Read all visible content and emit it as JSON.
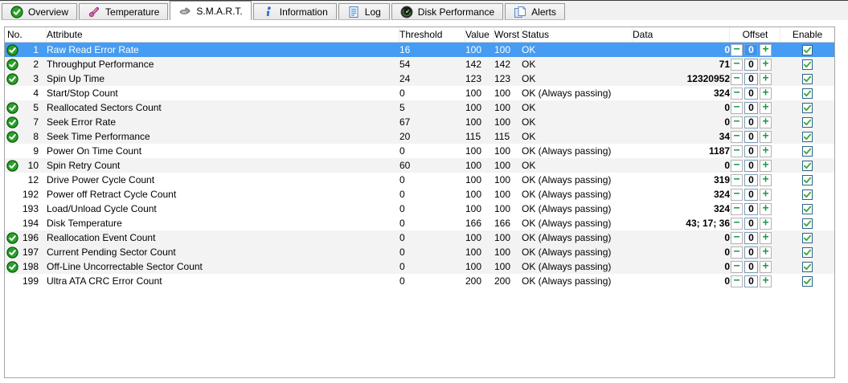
{
  "tabs": [
    {
      "label": "Overview",
      "icon": "check-circle-icon",
      "active": false
    },
    {
      "label": "Temperature",
      "icon": "thermometer-icon",
      "active": false
    },
    {
      "label": "S.M.A.R.T.",
      "icon": "smart-icon",
      "active": true
    },
    {
      "label": "Information",
      "icon": "info-icon",
      "active": false
    },
    {
      "label": "Log",
      "icon": "log-icon",
      "active": false
    },
    {
      "label": "Disk Performance",
      "icon": "gauge-icon",
      "active": false
    },
    {
      "label": "Alerts",
      "icon": "alerts-icon",
      "active": false
    }
  ],
  "table": {
    "headers": {
      "no": "No.",
      "attribute": "Attribute",
      "threshold": "Threshold",
      "value": "Value",
      "worst": "Worst",
      "status": "Status",
      "data": "Data",
      "offset": "Offset",
      "enable": "Enable"
    },
    "rows": [
      {
        "no": "1",
        "good": true,
        "selected": true,
        "attribute": "Raw Read Error Rate",
        "threshold": "16",
        "value": "100",
        "worst": "100",
        "status": "OK",
        "data": "0",
        "offset": "0",
        "enabled": true
      },
      {
        "no": "2",
        "good": true,
        "selected": false,
        "attribute": "Throughput Performance",
        "threshold": "54",
        "value": "142",
        "worst": "142",
        "status": "OK",
        "data": "71",
        "offset": "0",
        "enabled": true
      },
      {
        "no": "3",
        "good": true,
        "selected": false,
        "attribute": "Spin Up Time",
        "threshold": "24",
        "value": "123",
        "worst": "123",
        "status": "OK",
        "data": "12320952",
        "offset": "0",
        "enabled": true
      },
      {
        "no": "4",
        "good": false,
        "selected": false,
        "attribute": "Start/Stop Count",
        "threshold": "0",
        "value": "100",
        "worst": "100",
        "status": "OK (Always passing)",
        "data": "324",
        "offset": "0",
        "enabled": true
      },
      {
        "no": "5",
        "good": true,
        "selected": false,
        "attribute": "Reallocated Sectors Count",
        "threshold": "5",
        "value": "100",
        "worst": "100",
        "status": "OK",
        "data": "0",
        "offset": "0",
        "enabled": true
      },
      {
        "no": "7",
        "good": true,
        "selected": false,
        "attribute": "Seek Error Rate",
        "threshold": "67",
        "value": "100",
        "worst": "100",
        "status": "OK",
        "data": "0",
        "offset": "0",
        "enabled": true
      },
      {
        "no": "8",
        "good": true,
        "selected": false,
        "attribute": "Seek Time Performance",
        "threshold": "20",
        "value": "115",
        "worst": "115",
        "status": "OK",
        "data": "34",
        "offset": "0",
        "enabled": true
      },
      {
        "no": "9",
        "good": false,
        "selected": false,
        "attribute": "Power On Time Count",
        "threshold": "0",
        "value": "100",
        "worst": "100",
        "status": "OK (Always passing)",
        "data": "1187",
        "offset": "0",
        "enabled": true
      },
      {
        "no": "10",
        "good": true,
        "selected": false,
        "attribute": "Spin Retry Count",
        "threshold": "60",
        "value": "100",
        "worst": "100",
        "status": "OK",
        "data": "0",
        "offset": "0",
        "enabled": true
      },
      {
        "no": "12",
        "good": false,
        "selected": false,
        "attribute": "Drive Power Cycle Count",
        "threshold": "0",
        "value": "100",
        "worst": "100",
        "status": "OK (Always passing)",
        "data": "319",
        "offset": "0",
        "enabled": true
      },
      {
        "no": "192",
        "good": false,
        "selected": false,
        "attribute": "Power off Retract Cycle Count",
        "threshold": "0",
        "value": "100",
        "worst": "100",
        "status": "OK (Always passing)",
        "data": "324",
        "offset": "0",
        "enabled": true
      },
      {
        "no": "193",
        "good": false,
        "selected": false,
        "attribute": "Load/Unload Cycle Count",
        "threshold": "0",
        "value": "100",
        "worst": "100",
        "status": "OK (Always passing)",
        "data": "324",
        "offset": "0",
        "enabled": true
      },
      {
        "no": "194",
        "good": false,
        "selected": false,
        "attribute": "Disk Temperature",
        "threshold": "0",
        "value": "166",
        "worst": "166",
        "status": "OK (Always passing)",
        "data": "43; 17; 36",
        "offset": "0",
        "enabled": true
      },
      {
        "no": "196",
        "good": true,
        "selected": false,
        "attribute": "Reallocation Event Count",
        "threshold": "0",
        "value": "100",
        "worst": "100",
        "status": "OK (Always passing)",
        "data": "0",
        "offset": "0",
        "enabled": true
      },
      {
        "no": "197",
        "good": true,
        "selected": false,
        "attribute": "Current Pending Sector Count",
        "threshold": "0",
        "value": "100",
        "worst": "100",
        "status": "OK (Always passing)",
        "data": "0",
        "offset": "0",
        "enabled": true
      },
      {
        "no": "198",
        "good": true,
        "selected": false,
        "attribute": "Off-Line Uncorrectable Sector Count",
        "threshold": "0",
        "value": "100",
        "worst": "100",
        "status": "OK (Always passing)",
        "data": "0",
        "offset": "0",
        "enabled": true
      },
      {
        "no": "199",
        "good": false,
        "selected": false,
        "attribute": "Ultra ATA CRC Error Count",
        "threshold": "0",
        "value": "200",
        "worst": "200",
        "status": "OK (Always passing)",
        "data": "0",
        "offset": "0",
        "enabled": true
      }
    ]
  },
  "colors": {
    "selection_blue": "#459CF2",
    "good_green": "#28A228",
    "control_green": "#189A44",
    "shaded_row": "#F3F3F3"
  }
}
